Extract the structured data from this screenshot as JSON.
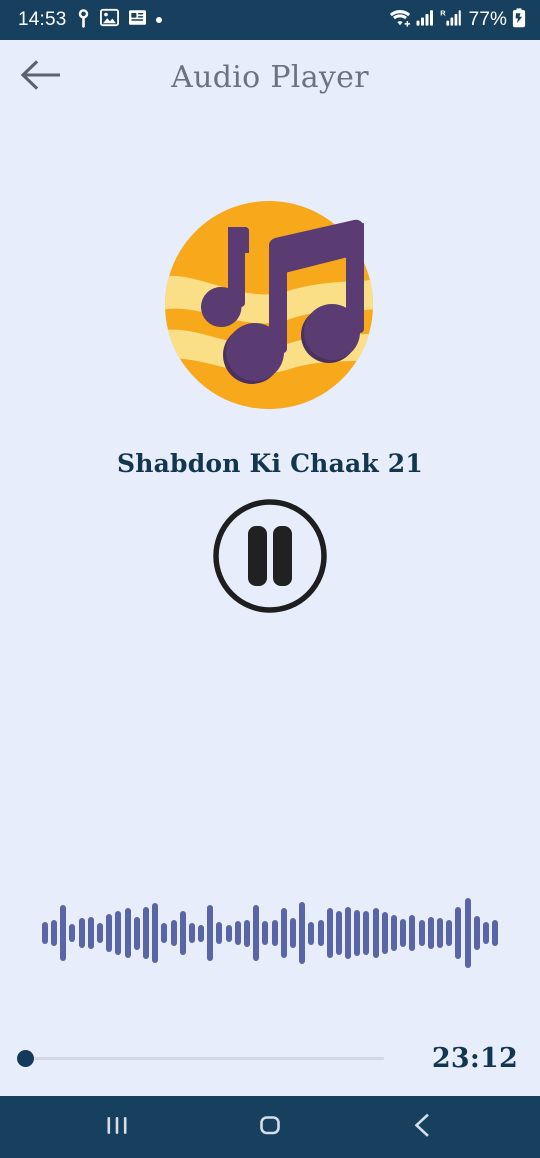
{
  "status_bar": {
    "time": "14:53",
    "battery_percent": "77%",
    "icons": [
      "location-pin-icon",
      "image-icon",
      "news-icon",
      "dot-icon"
    ],
    "right_icons": [
      "wifi-icon",
      "signal-bars-icon",
      "roaming-signal-icon",
      "battery-charging-icon"
    ],
    "background_color": "#17405f"
  },
  "app_bar": {
    "back_icon": "arrow-left-icon",
    "title": "Audio Player",
    "title_color": "#6b7280"
  },
  "player": {
    "album_art_icon": "music-note-logo",
    "album_art_colors": {
      "circle": "#f7a81b",
      "band": "#f9dd85",
      "note": "#5d3a6e"
    },
    "track_title": "Shabdon Ki Chaak 21",
    "track_title_color": "#12364f",
    "transport_button": {
      "state": "playing",
      "icon": "pause-icon",
      "color": "#1e1e1e"
    },
    "waveform": {
      "color": "#5a65a5",
      "heights": [
        22,
        26,
        56,
        18,
        30,
        32,
        20,
        38,
        44,
        50,
        33,
        52,
        60,
        20,
        26,
        44,
        20,
        17,
        56,
        22,
        17,
        24,
        27,
        56,
        24,
        26,
        50,
        30,
        62,
        23,
        26,
        50,
        44,
        52,
        46,
        44,
        50,
        42,
        36,
        28,
        36,
        26,
        32,
        30,
        26,
        52,
        70,
        34,
        22,
        26
      ]
    },
    "seek": {
      "position_label": "",
      "progress_percent": 0,
      "thumb_color": "#13395c",
      "track_color": "#d3d8e4",
      "duration": "23:12"
    }
  },
  "nav_bar": {
    "background_color": "#17405f",
    "buttons": [
      {
        "name": "recents-button",
        "icon": "recents-icon"
      },
      {
        "name": "home-button",
        "icon": "home-icon"
      },
      {
        "name": "back-button",
        "icon": "chevron-left-icon"
      }
    ]
  }
}
